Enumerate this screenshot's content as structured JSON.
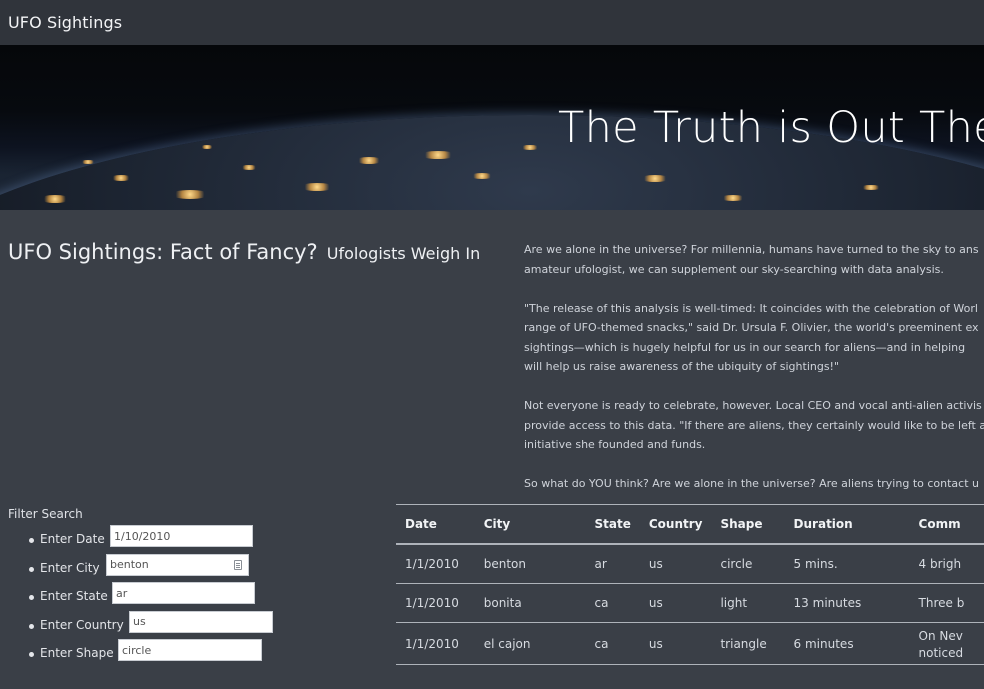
{
  "navbar": {
    "brand": "UFO Sightings"
  },
  "hero": {
    "title": "The Truth is Out There"
  },
  "article": {
    "heading": "UFO Sightings: Fact of Fancy?",
    "subheading": "Ufologists Weigh In",
    "lines": [
      [
        "Are we alone in the universe? For millennia, humans have turned to the sky to ans",
        "amateur ufologist, we can supplement our sky-searching with data analysis."
      ],
      [
        "\"The release of this analysis is well-timed: It coincides with the celebration of Worl",
        "range of UFO-themed snacks,\" said Dr. Ursula F. Olivier, the world's preeminent ex",
        "sightings—which is hugely helpful for us in our search for aliens—and in helping",
        "will help us raise awareness of the ubiquity of sightings!\""
      ],
      [
        "Not everyone is ready to celebrate, however. Local CEO and vocal anti-alien activis",
        "provide access to this data. \"If there are aliens, they certainly would like to be left a",
        "initiative she founded and funds."
      ],
      [
        "So what do YOU think? Are we alone in the universe? Are aliens trying to contact u"
      ]
    ]
  },
  "filters": {
    "title": "Filter Search",
    "items": [
      {
        "label": "Enter Date",
        "value": "1/10/2010"
      },
      {
        "label": "Enter City",
        "value": "benton"
      },
      {
        "label": "Enter State",
        "value": "ar"
      },
      {
        "label": "Enter Country",
        "value": "us"
      },
      {
        "label": "Enter Shape",
        "value": "circle"
      }
    ]
  },
  "table": {
    "headers": [
      "Date",
      "City",
      "State",
      "Country",
      "Shape",
      "Duration",
      "Comm"
    ],
    "rows": [
      [
        "1/1/2010",
        "benton",
        "ar",
        "us",
        "circle",
        "5 mins.",
        "4 brigh"
      ],
      [
        "1/1/2010",
        "bonita",
        "ca",
        "us",
        "light",
        "13 minutes",
        "Three b"
      ],
      [
        "1/1/2010",
        "el cajon",
        "ca",
        "us",
        "triangle",
        "6 minutes",
        "On Nev",
        "noticed"
      ]
    ]
  },
  "colors": {
    "page_bg": "#3a3f47",
    "navbar_bg": "#30343b",
    "text": "#e4e6ea"
  }
}
